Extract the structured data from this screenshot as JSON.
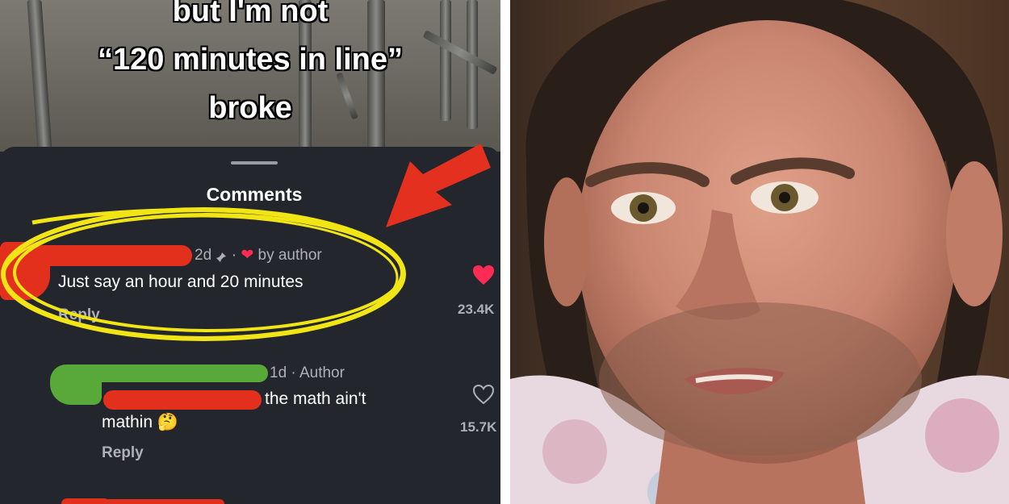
{
  "caption": {
    "line1": "but I'm not",
    "line2": "“120 minutes in line”",
    "line3": "broke"
  },
  "sheet": {
    "title": "Comments"
  },
  "comments": [
    {
      "age": "2d",
      "liked_by_author": "by author",
      "text": "Just say an hour and 20 minutes",
      "reply_label": "Reply",
      "likes": "23.4K"
    },
    {
      "age": "1d · Author",
      "text_line1": "the math ain't",
      "text_line2": "mathin 🤔",
      "reply_label": "Reply",
      "likes": "15.7K"
    }
  ],
  "colors": {
    "annotation_arrow": "#e4301f",
    "highlight_circle": "#f2e515",
    "redaction_red": "#e2301c",
    "redaction_green": "#58a83a",
    "heart": "#fe2c55"
  }
}
